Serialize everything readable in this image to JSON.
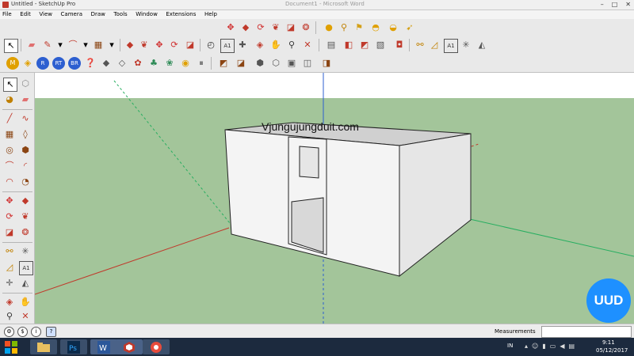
{
  "window": {
    "title": "Untitled - SketchUp Pro",
    "background_window_title": "Document1 - Microsoft Word",
    "controls": [
      "–",
      "□",
      "✕"
    ]
  },
  "menu": [
    "File",
    "Edit",
    "View",
    "Camera",
    "Draw",
    "Tools",
    "Window",
    "Extensions",
    "Help"
  ],
  "watermark": "Vjungujungduit.com",
  "status": {
    "measurements_label": "Measurements",
    "measurements_value": ""
  },
  "badge": "UUD",
  "taskbar": {
    "lang": "IN",
    "time": "9:11",
    "date": "05/12/2017",
    "apps": [
      "file-explorer",
      "photoshop",
      "word",
      "sketchup",
      "ccleaner"
    ]
  },
  "colors": {
    "sky": "#ffffff",
    "ground": "#a3c59a",
    "wall_light": "#f2f2f2",
    "wall_shade": "#d5d5d5",
    "axis_red": "#c0392b",
    "axis_green": "#27ae60",
    "axis_blue": "#2d5fd0",
    "taskbar": "#1c2a3e",
    "badge": "#1e90ff"
  }
}
